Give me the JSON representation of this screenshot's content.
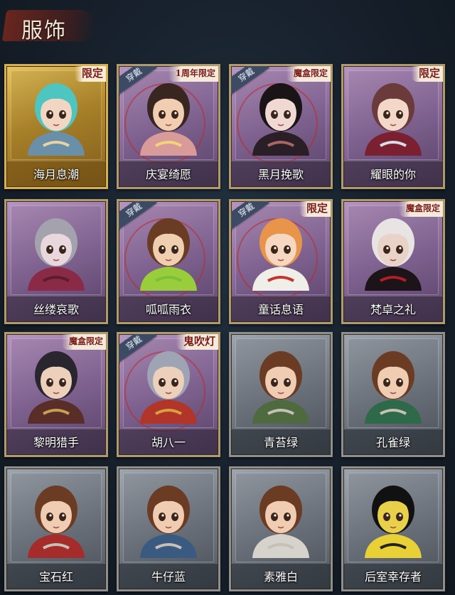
{
  "header": {
    "title": "服饰"
  },
  "cards": [
    {
      "name": "海月息潮",
      "style": "gold",
      "tag": "限定",
      "wear": "",
      "hair": "#4fc5c2",
      "skin": "#f2d6c4",
      "outfit": "#6a8fa8",
      "accent": "#e7d3a4"
    },
    {
      "name": "庆宴绮愿",
      "style": "purple",
      "tag": "1周年限定",
      "wear": "穿戴",
      "hair": "#3a2620",
      "skin": "#f1cdb2",
      "outfit": "#d99a9a",
      "accent": "#f2d37a"
    },
    {
      "name": "黑月挽歌",
      "style": "purple",
      "tag": "魔盒限定",
      "wear": "穿戴",
      "hair": "#1b1416",
      "skin": "#f0d9d2",
      "outfit": "#2a1f26",
      "accent": "#a66"
    },
    {
      "name": "耀眼的你",
      "style": "purple",
      "tag": "限定",
      "wear": "",
      "hair": "#6b3b3b",
      "skin": "#f3d7c8",
      "outfit": "#7a2030",
      "accent": "#d8dde6"
    },
    {
      "name": "丝缕哀歌",
      "style": "purple",
      "tag": "",
      "wear": "",
      "hair": "#a4a2ac",
      "skin": "#e8d8de",
      "outfit": "#8b2a47",
      "accent": "#5a1e2a"
    },
    {
      "name": "呱呱雨衣",
      "style": "purple",
      "tag": "",
      "wear": "穿戴",
      "hair": "#6a3c24",
      "skin": "#f0cfb0",
      "outfit": "#9acd3c",
      "accent": "#7bbf3a"
    },
    {
      "name": "童话息语",
      "style": "purple",
      "tag": "限定",
      "wear": "穿戴",
      "hair": "#e8944a",
      "skin": "#f6d8c2",
      "outfit": "#f0eee8",
      "accent": "#c8312c"
    },
    {
      "name": "梵卓之礼",
      "style": "purple",
      "tag": "魔盒限定",
      "wear": "",
      "hair": "#e8e4e4",
      "skin": "#e9d2c8",
      "outfit": "#1c1418",
      "accent": "#b01f24"
    },
    {
      "name": "黎明猎手",
      "style": "purple",
      "tag": "魔盒限定",
      "wear": "",
      "hair": "#2a2630",
      "skin": "#edd0bc",
      "outfit": "#5a2e28",
      "accent": "#c8a050"
    },
    {
      "name": "胡八一",
      "style": "purple",
      "tag": "鬼吹灯",
      "wear": "穿戴",
      "hair": "#9ea4b4",
      "skin": "#ecd0bb",
      "outfit": "#b2352a",
      "accent": "#d8a040"
    },
    {
      "name": "青苔绿",
      "style": "gray",
      "tag": "",
      "wear": "",
      "hair": "#6b3b24",
      "skin": "#f0cdb2",
      "outfit": "#4e6a3e",
      "accent": "#c6c0b6"
    },
    {
      "name": "孔雀绿",
      "style": "gray",
      "tag": "",
      "wear": "",
      "hair": "#6b3b24",
      "skin": "#f0cdb2",
      "outfit": "#2e6a4a",
      "accent": "#c6c0b6"
    },
    {
      "name": "宝石红",
      "style": "gray",
      "tag": "",
      "wear": "",
      "hair": "#6b3b24",
      "skin": "#f0cdb2",
      "outfit": "#a52c2a",
      "accent": "#c6c0b6"
    },
    {
      "name": "牛仔蓝",
      "style": "gray",
      "tag": "",
      "wear": "",
      "hair": "#6b3b24",
      "skin": "#f0cdb2",
      "outfit": "#3a5a82",
      "accent": "#c6c0b6"
    },
    {
      "name": "素雅白",
      "style": "gray",
      "tag": "",
      "wear": "",
      "hair": "#6b3b24",
      "skin": "#f0cdb2",
      "outfit": "#d6d2cc",
      "accent": "#c6c0b6"
    },
    {
      "name": "后室幸存者",
      "style": "gray",
      "tag": "",
      "wear": "",
      "hair": "#111111",
      "skin": "#e8d04a",
      "outfit": "#e8d036",
      "accent": "#222222"
    }
  ]
}
